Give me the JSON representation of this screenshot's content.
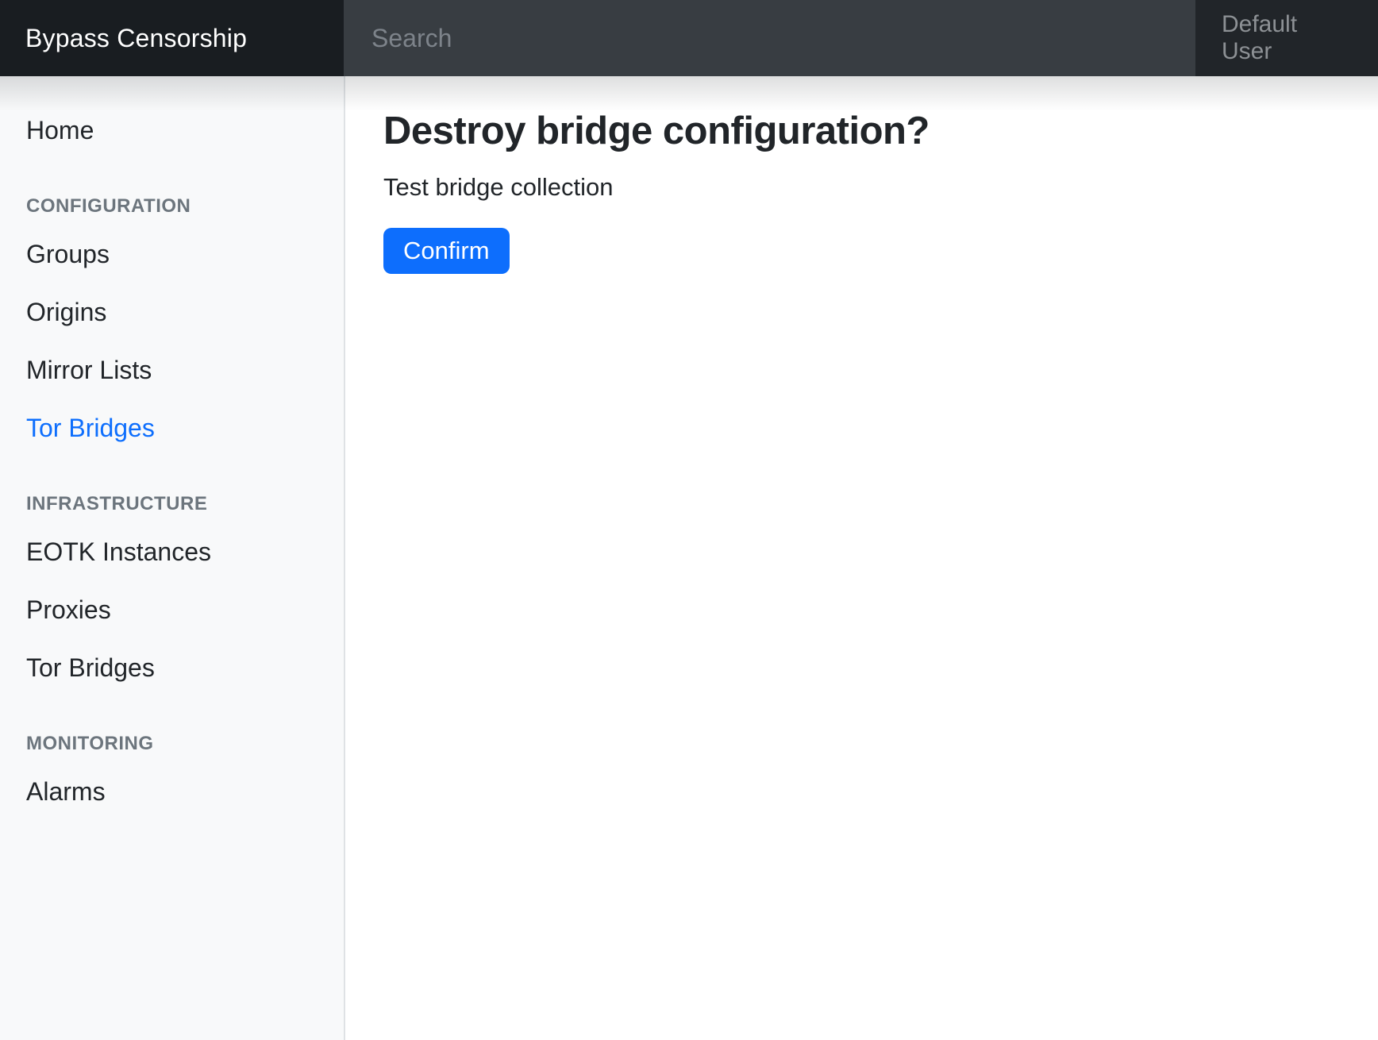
{
  "navbar": {
    "brand": "Bypass Censorship",
    "search": {
      "placeholder": "Search"
    },
    "user_menu": "Default User"
  },
  "sidebar": {
    "home": "Home",
    "sections": [
      {
        "header": "CONFIGURATION",
        "items": [
          "Groups",
          "Origins",
          "Mirror Lists",
          "Tor Bridges"
        ]
      },
      {
        "header": "INFRASTRUCTURE",
        "items": [
          "EOTK Instances",
          "Proxies",
          "Tor Bridges"
        ]
      },
      {
        "header": "MONITORING",
        "items": [
          "Alarms"
        ]
      }
    ],
    "active_item": "Tor Bridges"
  },
  "main": {
    "title": "Destroy bridge configuration?",
    "description": "Test bridge collection",
    "confirm_button": "Confirm"
  },
  "colors": {
    "accent_blue": "#0d6efd",
    "navbar_brand_bg": "#191d21",
    "navbar_search_bg": "#383d42",
    "navbar_user_bg": "#212529",
    "sidebar_bg": "#f8f9fa",
    "sidebar_border": "#dfe2e5",
    "muted_header_text": "#6c757d",
    "text_dark": "#212529"
  }
}
